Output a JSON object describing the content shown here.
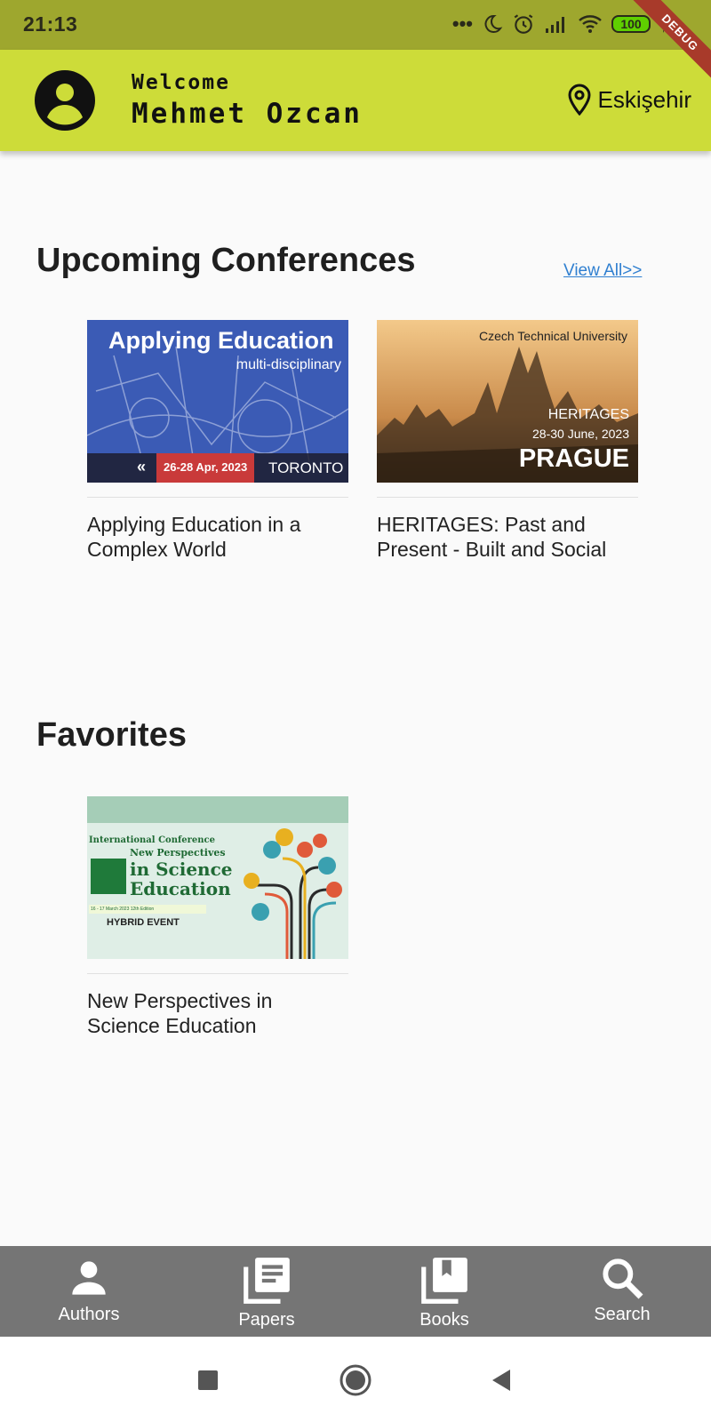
{
  "status_bar": {
    "time": "21:13",
    "battery": "100",
    "debug_label": "DEBUG"
  },
  "header": {
    "welcome": "Welcome",
    "user_name": "Mehmet Ozcan",
    "location": "Eskişehir"
  },
  "upcoming": {
    "title": "Upcoming Conferences",
    "view_all": "View All>>",
    "cards": [
      {
        "title": "Applying Education in a Complex World",
        "banner_title": "Applying Education",
        "banner_subtitle": "multi-disciplinary",
        "banner_dates": "26-28 Apr, 2023",
        "banner_city": "TORONTO"
      },
      {
        "title": "HERITAGES: Past and Present - Built and Social",
        "banner_org": "Czech Technical University",
        "banner_name": "HERITAGES",
        "banner_dates": "28-30 June, 2023",
        "banner_city": "PRAGUE"
      }
    ]
  },
  "favorites": {
    "title": "Favorites",
    "cards": [
      {
        "title": "New Perspectives in Science Education",
        "banner_line1": "International Conference",
        "banner_line2": "New Perspectives",
        "banner_line3": "in Science",
        "banner_line4": "Education",
        "banner_dates": "16 - 17 March 2023 12th Edition",
        "banner_event": "HYBRID EVENT"
      }
    ]
  },
  "bottom_nav": [
    {
      "label": "Authors",
      "icon": "person-icon"
    },
    {
      "label": "Papers",
      "icon": "papers-icon"
    },
    {
      "label": "Books",
      "icon": "books-icon"
    },
    {
      "label": "Search",
      "icon": "search-icon"
    }
  ],
  "colors": {
    "appbar": "#cddc39",
    "statusbar": "#9ea72e",
    "bottom_nav": "#757575",
    "link": "#2f7fd0"
  }
}
